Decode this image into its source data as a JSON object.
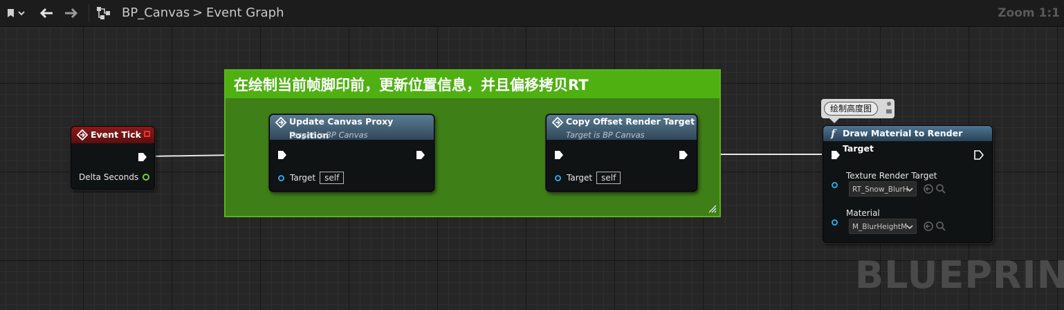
{
  "toolbar": {
    "breadcrumb_graph": "BP_Canvas",
    "breadcrumb_separator": ">",
    "breadcrumb_page": "Event Graph",
    "zoom_label": "Zoom 1:1"
  },
  "comment": {
    "title": "在绘制当前帧脚印前，更新位置信息，并且偏移拷贝RT",
    "color": "#4fb012"
  },
  "nodes": {
    "event_tick": {
      "title": "Event Tick",
      "pins": {
        "delta": "Delta Seconds"
      },
      "header_color": "#7d1414"
    },
    "update_canvas": {
      "title": "Update Canvas Proxy Position",
      "subtitle": "Target is BP Canvas",
      "target_label": "Target",
      "target_value": "self"
    },
    "copy_offset": {
      "title": "Copy Offset Render Target",
      "subtitle": "Target is BP Canvas",
      "target_label": "Target",
      "target_value": "self"
    },
    "draw_material": {
      "title": "Draw Material to Render Target",
      "comment_bubble": "绘制高度图",
      "texture_label": "Texture Render Target",
      "texture_value": "RT_Snow_BlurH",
      "material_label": "Material",
      "material_value": "M_BlurHeightM"
    }
  },
  "watermark": "BLUEPRINT",
  "icons": [
    "bookmark-icon",
    "back-arrow-icon",
    "forward-arrow-icon",
    "graph-icon",
    "event-icon",
    "function-icon",
    "exec-pin-icon",
    "search-icon",
    "reset-arrow-icon"
  ]
}
